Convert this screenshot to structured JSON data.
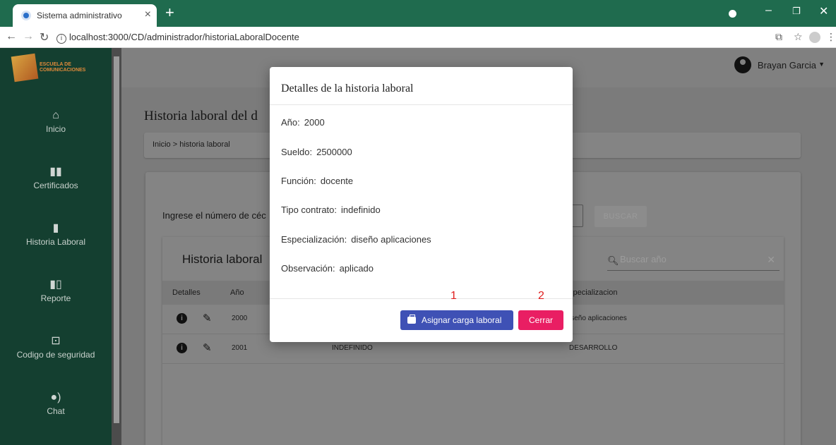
{
  "browser": {
    "tab_title": "Sistema administrativo",
    "tab_close": "×",
    "new_tab": "+",
    "url": "localhost:3000/CD/administrador/historiaLaboralDocente"
  },
  "sidebar": {
    "logo_text": "ESCUELA DE COMUNICACIONES",
    "items": [
      {
        "label": "Inicio",
        "icon": "home-icon"
      },
      {
        "label": "Certificados",
        "icon": "book-icon"
      },
      {
        "label": "Historia Laboral",
        "icon": "book-icon"
      },
      {
        "label": "Reporte",
        "icon": "book-open-icon"
      },
      {
        "label": "Codigo de seguridad",
        "icon": "lock-icon"
      },
      {
        "label": "Chat",
        "icon": "record-voice-icon"
      }
    ]
  },
  "header": {
    "user_name": "Brayan Garcia"
  },
  "page": {
    "title": "Historia laboral del d",
    "breadcrumb": "Inicio > historia laboral",
    "prompt": "Ingrese el número de céc",
    "search_button": "BUSCAR"
  },
  "table": {
    "title": "Historia laboral",
    "search_placeholder": "Buscar año",
    "columns": [
      "Detalles",
      "Año",
      "specializacion"
    ],
    "rows": [
      {
        "year": "2000",
        "contract": "",
        "specialization": "iseño aplicaciones"
      },
      {
        "year": "2001",
        "contract": "INDEFINIDO",
        "specialization": "DESARROLLO"
      }
    ]
  },
  "modal": {
    "title": "Detalles de la historia laboral",
    "fields": [
      {
        "label": "Año:",
        "value": "2000"
      },
      {
        "label": "Sueldo:",
        "value": "2500000"
      },
      {
        "label": "Función:",
        "value": "docente"
      },
      {
        "label": "Tipo contrato:",
        "value": "indefinido"
      },
      {
        "label": "Especialización:",
        "value": "diseño aplicaciones"
      },
      {
        "label": "Observación:",
        "value": "aplicado"
      }
    ],
    "assign_button": "Asignar carga laboral",
    "close_button": "Cerrar",
    "annotation_1": "1",
    "annotation_2": "2"
  },
  "colors": {
    "assign_button": "#3f51b5",
    "close_button": "#e91e63",
    "sidebar": "#143f30",
    "tabbar": "#1f6b4e"
  }
}
